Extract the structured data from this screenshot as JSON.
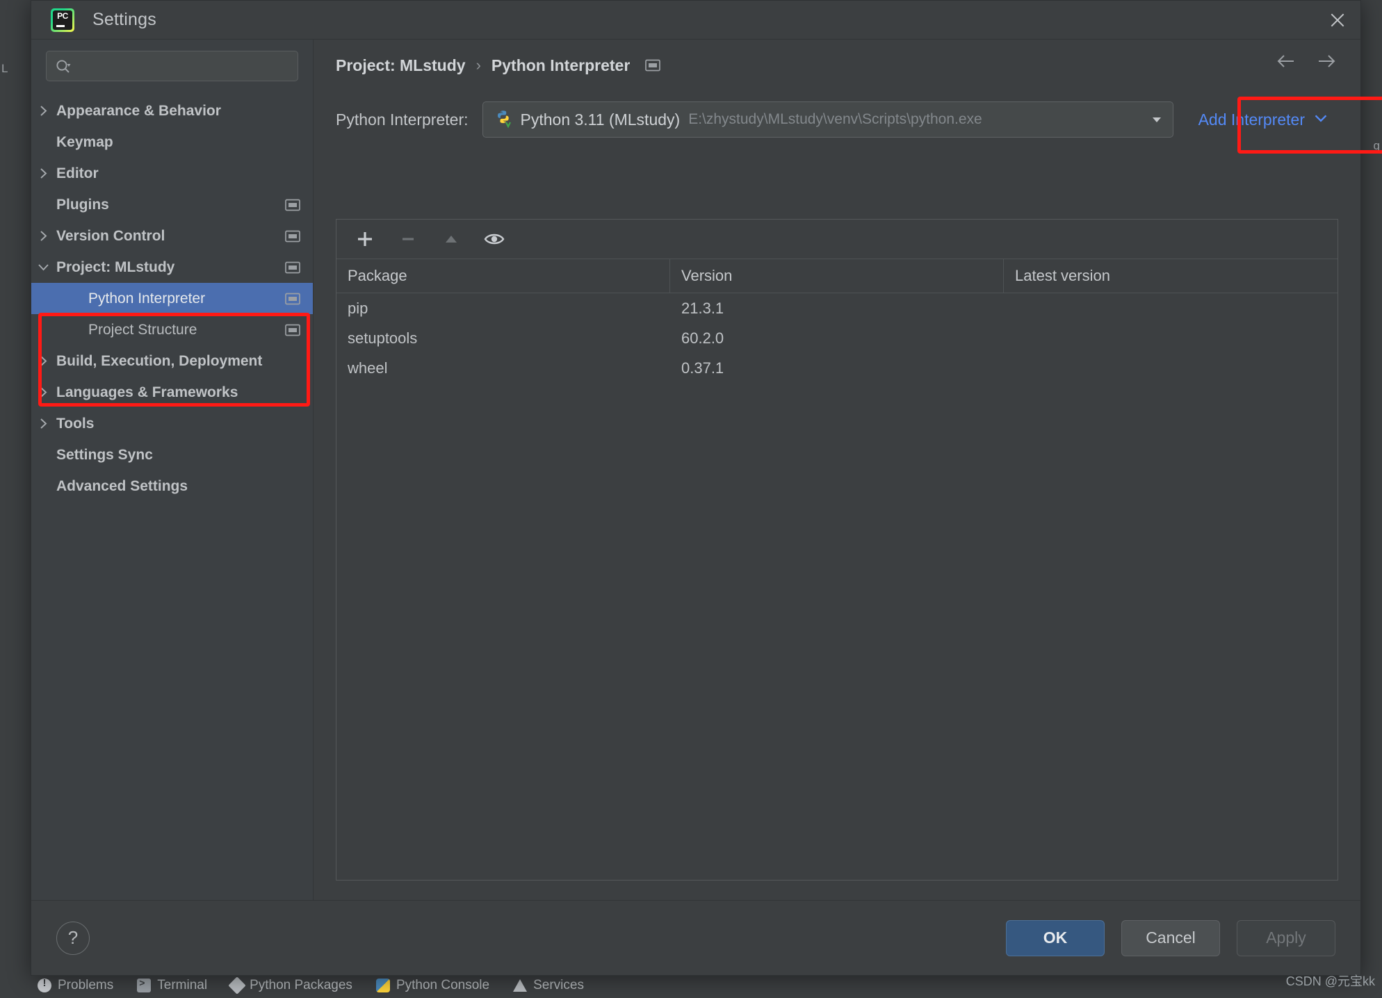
{
  "window": {
    "title": "Settings",
    "logo_icon": "pycharm-logo-icon",
    "close_icon": "close-icon"
  },
  "sidebar": {
    "search": {
      "placeholder": "",
      "value": "",
      "icon": "search-icon"
    },
    "items": [
      {
        "label": "Appearance & Behavior",
        "level": "top",
        "expandable": true,
        "expanded": false,
        "monitor": false,
        "selected": false
      },
      {
        "label": "Keymap",
        "level": "top",
        "expandable": false,
        "expanded": false,
        "monitor": false,
        "selected": false
      },
      {
        "label": "Editor",
        "level": "top",
        "expandable": true,
        "expanded": false,
        "monitor": false,
        "selected": false
      },
      {
        "label": "Plugins",
        "level": "top",
        "expandable": false,
        "expanded": false,
        "monitor": true,
        "selected": false
      },
      {
        "label": "Version Control",
        "level": "top",
        "expandable": true,
        "expanded": false,
        "monitor": true,
        "selected": false
      },
      {
        "label": "Project: MLstudy",
        "level": "top",
        "expandable": true,
        "expanded": true,
        "monitor": true,
        "selected": false
      },
      {
        "label": "Python Interpreter",
        "level": "child",
        "expandable": false,
        "expanded": false,
        "monitor": true,
        "selected": true
      },
      {
        "label": "Project Structure",
        "level": "child",
        "expandable": false,
        "expanded": false,
        "monitor": true,
        "selected": false
      },
      {
        "label": "Build, Execution, Deployment",
        "level": "top",
        "expandable": true,
        "expanded": false,
        "monitor": false,
        "selected": false
      },
      {
        "label": "Languages & Frameworks",
        "level": "top",
        "expandable": true,
        "expanded": false,
        "monitor": false,
        "selected": false
      },
      {
        "label": "Tools",
        "level": "top",
        "expandable": true,
        "expanded": false,
        "monitor": false,
        "selected": false
      },
      {
        "label": "Settings Sync",
        "level": "top",
        "expandable": false,
        "expanded": false,
        "monitor": false,
        "selected": false
      },
      {
        "label": "Advanced Settings",
        "level": "top",
        "expandable": false,
        "expanded": false,
        "monitor": false,
        "selected": false
      }
    ]
  },
  "breadcrumb": {
    "root": "Project: MLstudy",
    "separator": "›",
    "leaf": "Python Interpreter",
    "monitor_icon": "monitor-icon",
    "back_icon": "arrow-left-icon",
    "forward_icon": "arrow-right-icon"
  },
  "interpreter": {
    "label": "Python Interpreter:",
    "icon": "python-venv-icon",
    "value": "Python 3.11 (MLstudy)",
    "path": "E:\\zhystudy\\MLstudy\\venv\\Scripts\\python.exe",
    "dropdown_icon": "chevron-down-icon",
    "add_label": "Add Interpreter",
    "add_icon": "chevron-down-icon"
  },
  "packages": {
    "toolbar": [
      {
        "name": "add-package-button",
        "icon": "plus-icon",
        "enabled": true
      },
      {
        "name": "remove-package-button",
        "icon": "minus-icon",
        "enabled": false
      },
      {
        "name": "upgrade-package-button",
        "icon": "triangle-up-icon",
        "enabled": false
      },
      {
        "name": "show-early-releases-button",
        "icon": "eye-icon",
        "enabled": true
      }
    ],
    "columns": [
      "Package",
      "Version",
      "Latest version"
    ],
    "rows": [
      {
        "package": "pip",
        "version": "21.3.1",
        "latest": ""
      },
      {
        "package": "setuptools",
        "version": "60.2.0",
        "latest": ""
      },
      {
        "package": "wheel",
        "version": "0.37.1",
        "latest": ""
      }
    ]
  },
  "footer": {
    "help_label": "?",
    "ok_label": "OK",
    "cancel_label": "Cancel",
    "apply_label": "Apply"
  },
  "statusbar": {
    "items": [
      {
        "label": "Problems",
        "icon": "problems-icon"
      },
      {
        "label": "Terminal",
        "icon": "terminal-icon"
      },
      {
        "label": "Python Packages",
        "icon": "python-packages-icon"
      },
      {
        "label": "Python Console",
        "icon": "python-console-icon"
      },
      {
        "label": "Services",
        "icon": "services-icon"
      }
    ]
  },
  "ide": {
    "left_label": "L",
    "right_label": "g"
  },
  "watermark": "CSDN @元宝kk",
  "colors": {
    "accent_blue": "#548af7",
    "selection_blue": "#4b6eaf",
    "primary_button": "#365880",
    "annotation_red": "#ff1a15",
    "panel_bg": "#3c3f41",
    "sidebar_bg": "#3c4043"
  }
}
